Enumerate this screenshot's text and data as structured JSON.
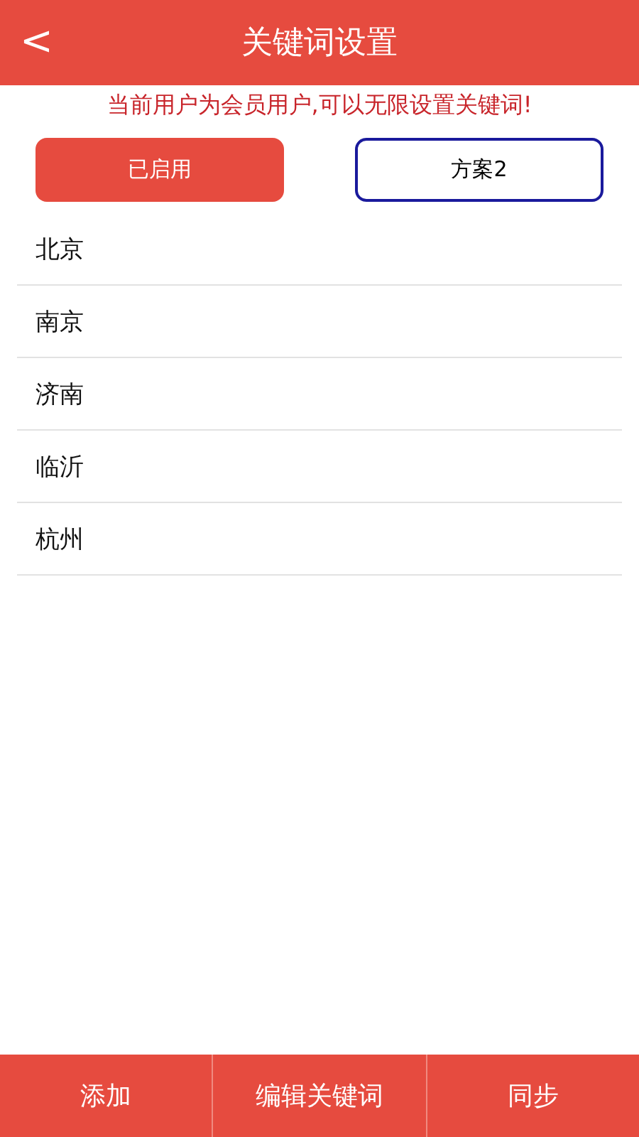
{
  "header": {
    "back": "<",
    "title": "关键词设置"
  },
  "notice": "当前用户为会员用户,可以无限设置关键词!",
  "tabs": [
    {
      "label": "已启用",
      "selected": true
    },
    {
      "label": "方案2",
      "selected": false
    }
  ],
  "keywords": [
    "北京",
    "南京",
    "济南",
    "临沂",
    "杭州"
  ],
  "bottom_bar": [
    "添加",
    "编辑关键词",
    "同步"
  ]
}
